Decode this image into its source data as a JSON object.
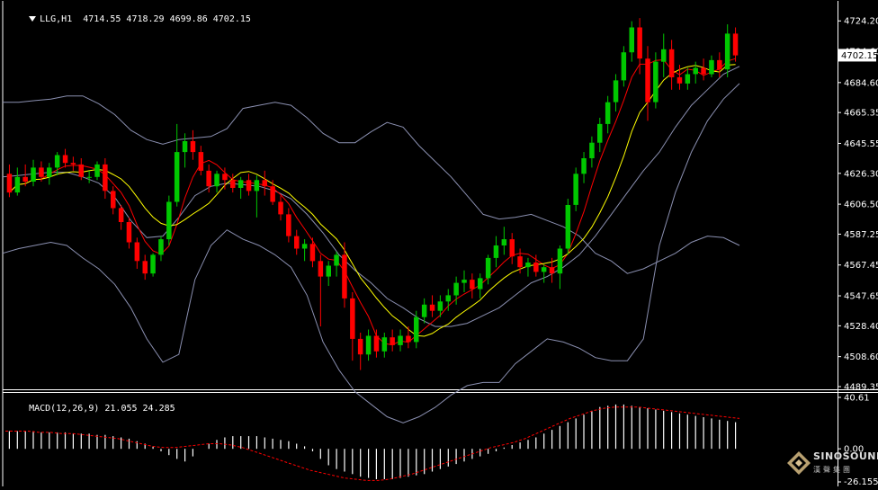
{
  "header": {
    "dropdown_icon": "triangle-down-icon",
    "symbol": "LLG,H1",
    "ohlc": "4714.55 4718.29 4699.86 4702.15"
  },
  "macd_header": {
    "label": "MACD(12,26,9) 21.055 24.285"
  },
  "branding": {
    "name": "SINOSOUND",
    "cn": "漢聲集團",
    "icon": "diamond-logo-icon"
  },
  "colors": {
    "background": "#000000",
    "bull": "#00c800",
    "bear": "#ff0000",
    "bollinger": "#8a8fb0",
    "fast_ma": "#ff0000",
    "slow_ma": "#ffff00",
    "macd_hist": "#ffffff",
    "macd_signal": "#ff0000",
    "border": "#ffffff",
    "price_tag_bg": "#ffffff",
    "price_tag_text": "#000000"
  },
  "chart_data": [
    {
      "type": "candlestick",
      "panel": "price",
      "symbol": "LLG",
      "timeframe": "H1",
      "ylim": [
        4489.35,
        4733.0
      ],
      "y_ticks": [
        "4724.20",
        "4704.60",
        "4684.60",
        "4665.35",
        "4645.55",
        "4626.30",
        "4606.50",
        "4587.25",
        "4567.45",
        "4547.65",
        "4528.40",
        "4508.60",
        "4489.35"
      ],
      "current_price_label": "4702.15",
      "candles": [
        [
          4626,
          4632,
          4611,
          4614
        ],
        [
          4614,
          4630,
          4612,
          4624
        ],
        [
          4624,
          4632,
          4618,
          4621
        ],
        [
          4621,
          4635,
          4618,
          4630
        ],
        [
          4630,
          4634,
          4621,
          4624
        ],
        [
          4624,
          4633,
          4619,
          4630
        ],
        [
          4630,
          4640,
          4625,
          4638
        ],
        [
          4638,
          4642,
          4630,
          4633
        ],
        [
          4633,
          4637,
          4628,
          4632
        ],
        [
          4632,
          4636,
          4622,
          4624
        ],
        [
          4624,
          4628,
          4620,
          4624
        ],
        [
          4624,
          4634,
          4622,
          4632
        ],
        [
          4632,
          4636,
          4610,
          4615
        ],
        [
          4615,
          4618,
          4600,
          4604
        ],
        [
          4604,
          4606,
          4590,
          4595
        ],
        [
          4595,
          4598,
          4578,
          4582
        ],
        [
          4582,
          4585,
          4565,
          4570
        ],
        [
          4570,
          4574,
          4558,
          4562
        ],
        [
          4562,
          4575,
          4560,
          4574
        ],
        [
          4574,
          4586,
          4570,
          4584
        ],
        [
          4584,
          4612,
          4580,
          4608
        ],
        [
          4608,
          4658,
          4605,
          4640
        ],
        [
          4640,
          4652,
          4630,
          4647
        ],
        [
          4647,
          4654,
          4635,
          4640
        ],
        [
          4640,
          4644,
          4625,
          4628
        ],
        [
          4628,
          4632,
          4614,
          4618
        ],
        [
          4618,
          4628,
          4614,
          4626
        ],
        [
          4626,
          4630,
          4616,
          4622
        ],
        [
          4622,
          4626,
          4614,
          4617
        ],
        [
          4617,
          4624,
          4610,
          4622
        ],
        [
          4622,
          4626,
          4612,
          4615
        ],
        [
          4615,
          4625,
          4598,
          4622
        ],
        [
          4622,
          4628,
          4612,
          4618
        ],
        [
          4618,
          4622,
          4606,
          4608
        ],
        [
          4608,
          4612,
          4596,
          4600
        ],
        [
          4600,
          4604,
          4582,
          4586
        ],
        [
          4586,
          4590,
          4574,
          4578
        ],
        [
          4578,
          4584,
          4570,
          4581
        ],
        [
          4581,
          4585,
          4566,
          4570
        ],
        [
          4570,
          4574,
          4528,
          4560
        ],
        [
          4560,
          4570,
          4554,
          4567
        ],
        [
          4567,
          4576,
          4560,
          4574
        ],
        [
          4574,
          4582,
          4540,
          4546
        ],
        [
          4546,
          4550,
          4506,
          4520
        ],
        [
          4520,
          4524,
          4500,
          4510
        ],
        [
          4510,
          4526,
          4506,
          4522
        ],
        [
          4522,
          4526,
          4508,
          4512
        ],
        [
          4512,
          4524,
          4508,
          4521
        ],
        [
          4521,
          4526,
          4512,
          4516
        ],
        [
          4516,
          4526,
          4512,
          4522
        ],
        [
          4522,
          4528,
          4514,
          4518
        ],
        [
          4518,
          4538,
          4514,
          4534
        ],
        [
          4534,
          4546,
          4530,
          4542
        ],
        [
          4542,
          4548,
          4534,
          4538
        ],
        [
          4538,
          4548,
          4534,
          4544
        ],
        [
          4544,
          4552,
          4538,
          4548
        ],
        [
          4548,
          4560,
          4542,
          4556
        ],
        [
          4556,
          4564,
          4550,
          4558
        ],
        [
          4558,
          4562,
          4546,
          4552
        ],
        [
          4552,
          4562,
          4546,
          4559
        ],
        [
          4559,
          4574,
          4555,
          4572
        ],
        [
          4572,
          4586,
          4566,
          4580
        ],
        [
          4580,
          4592,
          4574,
          4584
        ],
        [
          4584,
          4588,
          4568,
          4573
        ],
        [
          4573,
          4578,
          4562,
          4566
        ],
        [
          4566,
          4572,
          4560,
          4569
        ],
        [
          4569,
          4574,
          4560,
          4563
        ],
        [
          4563,
          4568,
          4556,
          4566
        ],
        [
          4566,
          4572,
          4556,
          4562
        ],
        [
          4562,
          4580,
          4552,
          4578
        ],
        [
          4578,
          4610,
          4574,
          4606
        ],
        [
          4606,
          4630,
          4602,
          4626
        ],
        [
          4626,
          4640,
          4620,
          4636
        ],
        [
          4636,
          4650,
          4630,
          4646
        ],
        [
          4646,
          4662,
          4640,
          4658
        ],
        [
          4658,
          4676,
          4652,
          4672
        ],
        [
          4672,
          4690,
          4666,
          4686
        ],
        [
          4686,
          4708,
          4682,
          4704
        ],
        [
          4704,
          4724,
          4698,
          4720
        ],
        [
          4720,
          4726,
          4690,
          4700
        ],
        [
          4700,
          4708,
          4660,
          4672
        ],
        [
          4672,
          4704,
          4668,
          4698
        ],
        [
          4698,
          4716,
          4688,
          4706
        ],
        [
          4706,
          4712,
          4680,
          4688
        ],
        [
          4688,
          4696,
          4680,
          4684
        ],
        [
          4684,
          4694,
          4680,
          4690
        ],
        [
          4690,
          4698,
          4684,
          4694
        ],
        [
          4694,
          4700,
          4686,
          4690
        ],
        [
          4690,
          4702,
          4688,
          4699
        ],
        [
          4699,
          4704,
          4688,
          4693
        ],
        [
          4693,
          4722,
          4688,
          4716
        ],
        [
          4716,
          4720,
          4698,
          4702
        ]
      ],
      "bollinger": {
        "upper": [
          4672,
          4672,
          4673,
          4674,
          4676,
          4676,
          4671,
          4664,
          4654,
          4648,
          4645,
          4648,
          4649,
          4650,
          4655,
          4668,
          4670,
          4672,
          4670,
          4662,
          4652,
          4646,
          4646,
          4653,
          4659,
          4656,
          4644,
          4634,
          4624,
          4612,
          4600,
          4597,
          4598,
          4600,
          4596,
          4592,
          4586,
          4575,
          4570,
          4562,
          4565,
          4570,
          4575,
          4582,
          4586,
          4585,
          4580
        ],
        "middle": [
          4624,
          4625,
          4626,
          4627,
          4627,
          4624,
          4620,
          4611,
          4596,
          4585,
          4586,
          4598,
          4612,
          4618,
          4620,
          4619,
          4618,
          4615,
          4610,
          4600,
          4588,
          4574,
          4564,
          4556,
          4546,
          4540,
          4533,
          4528,
          4528,
          4530,
          4535,
          4540,
          4548,
          4556,
          4560,
          4566,
          4574,
          4586,
          4600,
          4614,
          4628,
          4640,
          4656,
          4670,
          4680,
          4690,
          4695
        ],
        "lower": [
          4575,
          4578,
          4580,
          4582,
          4580,
          4572,
          4565,
          4555,
          4540,
          4520,
          4505,
          4510,
          4558,
          4580,
          4590,
          4584,
          4580,
          4574,
          4566,
          4548,
          4518,
          4500,
          4486,
          4478,
          4470,
          4466,
          4470,
          4476,
          4484,
          4490,
          4492,
          4492,
          4504,
          4512,
          4520,
          4518,
          4514,
          4508,
          4506,
          4506,
          4520,
          4580,
          4614,
          4640,
          4660,
          4674,
          4684
        ]
      },
      "moving_averages": [
        {
          "name": "fast",
          "period": 5
        },
        {
          "name": "slow",
          "period": 10
        }
      ]
    },
    {
      "type": "bar",
      "panel": "macd",
      "title": "MACD(12,26,9)",
      "values_label": "21.055 24.285",
      "ylim": [
        -26.155,
        40.61
      ],
      "y_ticks": [
        "40.61",
        "0.00",
        "-26.155"
      ],
      "histogram": [
        14,
        14,
        14,
        14,
        13,
        13,
        13,
        13,
        12,
        12,
        12,
        11,
        11,
        10,
        9,
        8,
        6,
        4,
        2,
        -2,
        -5,
        -8,
        -10,
        -6,
        0,
        4,
        7,
        9,
        10,
        10,
        10,
        10,
        9,
        8,
        7,
        6,
        4,
        2,
        -2,
        -8,
        -13,
        -16,
        -18,
        -20,
        -22,
        -23,
        -24,
        -24,
        -24,
        -23,
        -22,
        -21,
        -20,
        -18,
        -16,
        -14,
        -12,
        -10,
        -8,
        -6,
        -4,
        -2,
        1,
        3,
        5,
        7,
        9,
        12,
        15,
        18,
        21,
        24,
        27,
        30,
        33,
        34,
        35,
        35,
        34,
        33,
        32,
        31,
        30,
        29,
        28,
        27,
        26,
        25,
        24,
        23,
        22,
        21
      ],
      "signal": [
        14,
        14,
        14,
        13,
        13,
        12,
        12,
        11,
        10,
        9,
        8,
        6,
        4,
        2,
        1,
        1,
        2,
        3,
        4,
        4,
        3,
        1,
        -2,
        -5,
        -8,
        -11,
        -14,
        -17,
        -19,
        -21,
        -23,
        -24,
        -25,
        -25,
        -24,
        -22,
        -20,
        -17,
        -14,
        -11,
        -8,
        -5,
        -2,
        1,
        3,
        5,
        8,
        12,
        16,
        20,
        24,
        27,
        30,
        32,
        33,
        33,
        33,
        32,
        31,
        30,
        29,
        28,
        27,
        26,
        25,
        24
      ]
    }
  ]
}
